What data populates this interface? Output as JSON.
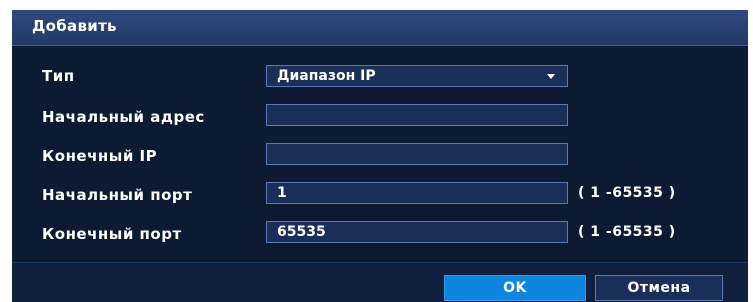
{
  "dialog": {
    "title": "Добавить"
  },
  "form": {
    "type": {
      "label": "Тип",
      "value": "Диапазон IP"
    },
    "start_address": {
      "label": "Начальный адрес",
      "value": ""
    },
    "end_ip": {
      "label": "Конечный IP",
      "value": ""
    },
    "start_port": {
      "label": "Начальный порт",
      "value": "1",
      "range": "( 1 -65535 )"
    },
    "end_port": {
      "label": "Конечный порт",
      "value": "65535",
      "range": "( 1 -65535 )"
    }
  },
  "buttons": {
    "ok_label": "OK",
    "cancel_label": "Отмена"
  },
  "colors": {
    "background": "#0c1a33",
    "title_bar": "#2e4a7d",
    "field_bg": "#1a2f57",
    "field_border": "#5b7ab5",
    "primary_button": "#0d86e0"
  },
  "icons": {
    "dropdown": "chevron-down-icon"
  }
}
